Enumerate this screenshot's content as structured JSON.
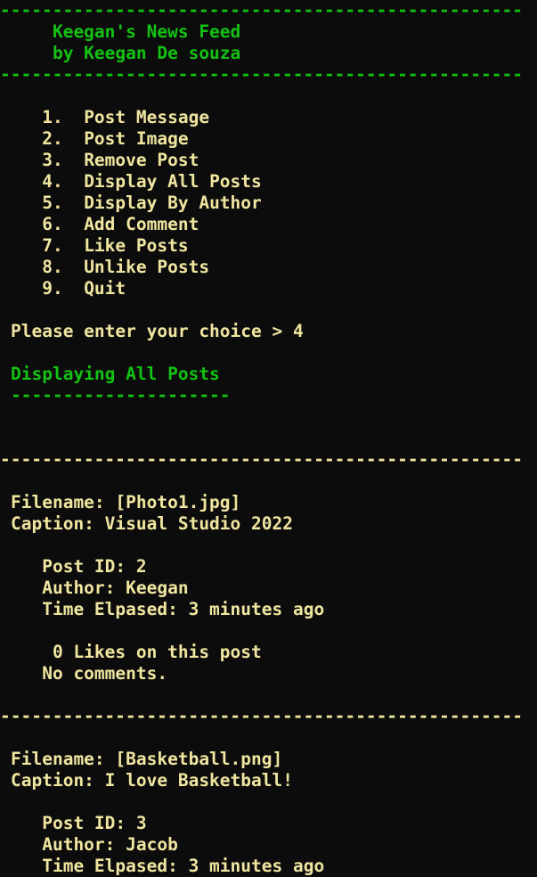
{
  "header": {
    "top_rule": "--------------------------------------------------",
    "title": "    Keegan's News Feed",
    "byline": "    by Keegan De souza",
    "bottom_rule": "--------------------------------------------------"
  },
  "menu": {
    "items": [
      {
        "number": "   1.",
        "label": "Post Message"
      },
      {
        "number": "   2.",
        "label": "Post Image"
      },
      {
        "number": "   3.",
        "label": "Remove Post"
      },
      {
        "number": "   4.",
        "label": "Display All Posts"
      },
      {
        "number": "   5.",
        "label": "Display By Author"
      },
      {
        "number": "   6.",
        "label": "Add Comment"
      },
      {
        "number": "   7.",
        "label": "Like Posts"
      },
      {
        "number": "   8.",
        "label": "Unlike Posts"
      },
      {
        "number": "   9.",
        "label": "Quit"
      }
    ]
  },
  "prompt": {
    "text": "Please enter your choice > ",
    "value": "4"
  },
  "section": {
    "title": "Displaying All Posts",
    "underline": "---------------------"
  },
  "post_rule": "--------------------------------------------------",
  "posts": [
    {
      "filename": "Filename: [Photo1.jpg]",
      "caption": "Caption: Visual Studio 2022",
      "post_id": "   Post ID: 2",
      "author": "   Author: Keegan",
      "time": "   Time Elpased: 3 minutes ago",
      "likes": "    0 Likes on this post",
      "comments": "   No comments."
    },
    {
      "filename": "Filename: [Basketball.png]",
      "caption": "Caption: I love Basketball!",
      "post_id": "   Post ID: 3",
      "author": "   Author: Jacob",
      "time": "   Time Elpased: 3 minutes ago"
    }
  ],
  "colors": {
    "background": "#0c0c0c",
    "text": "#f0e6a0",
    "accent": "#13c213"
  }
}
